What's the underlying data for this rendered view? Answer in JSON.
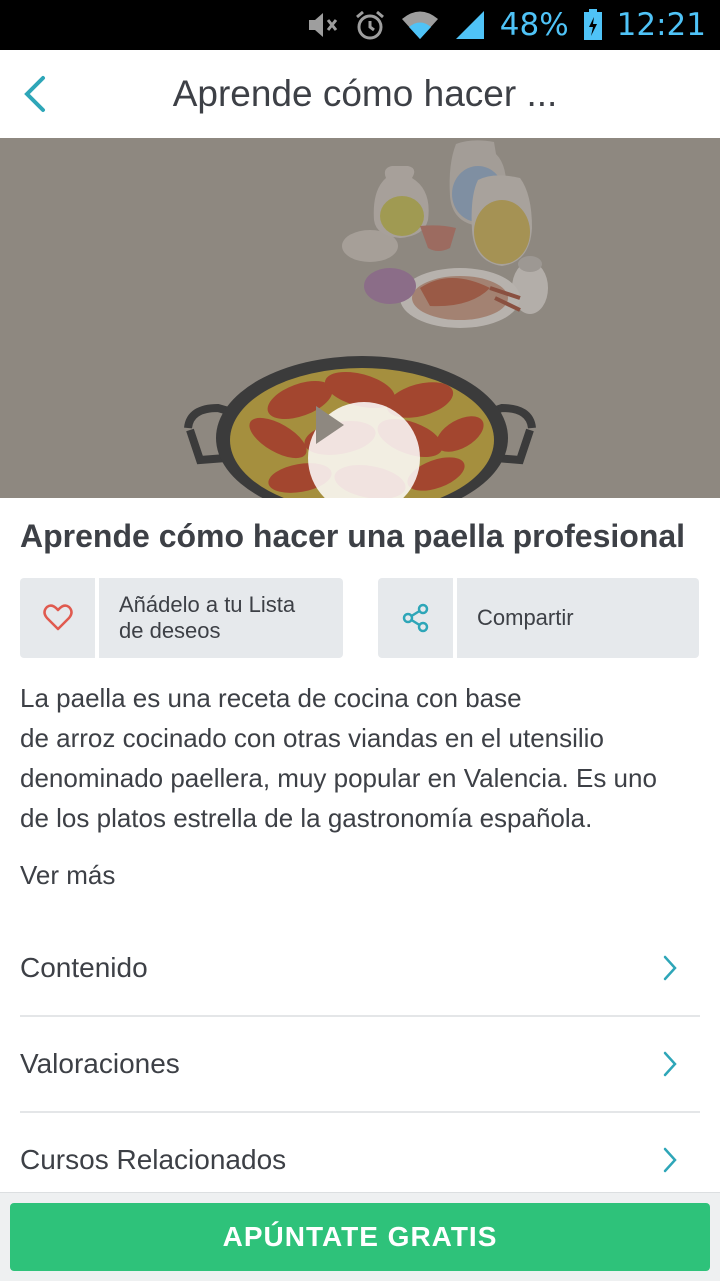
{
  "status_bar": {
    "battery": "48%",
    "time": "12:21",
    "icons": [
      "mute-icon",
      "alarm-icon",
      "wifi-icon",
      "signal-icon",
      "battery-icon"
    ]
  },
  "header": {
    "title": "Aprende cómo hacer ...",
    "back_icon": "chevron-left-icon"
  },
  "hero": {
    "play_icon": "play-icon"
  },
  "course": {
    "title": "Aprende cómo hacer una paella profesional"
  },
  "actions": {
    "wishlist_label_line1": "Añádelo a tu Lista",
    "wishlist_label_line2": "de deseos",
    "wishlist_icon": "heart-icon",
    "share_label": "Compartir",
    "share_icon": "share-icon"
  },
  "description": {
    "line1": "La paella es una receta de cocina con base",
    "line2": "de arroz cocinado con otras viandas en el utensilio",
    "line3": "denominado paellera, muy popular en Valencia. Es uno",
    "line4": "de los platos estrella de la gastronomía española.",
    "see_more": "Ver más"
  },
  "sections": [
    {
      "label": "Contenido"
    },
    {
      "label": "Valoraciones"
    },
    {
      "label": "Cursos Relacionados"
    }
  ],
  "cta": {
    "label": "APÚNTATE GRATIS"
  },
  "colors": {
    "accent": "#2ea6b8",
    "cta": "#2ec27a",
    "heart": "#e05a4f",
    "text": "#3d4046"
  }
}
